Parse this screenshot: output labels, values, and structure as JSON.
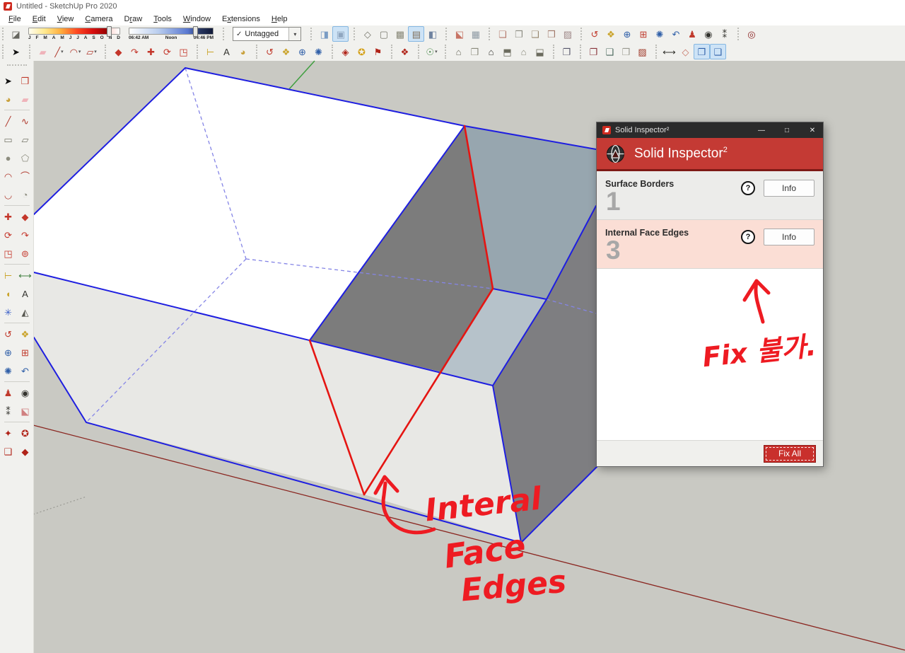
{
  "window": {
    "title": "Untitled - SketchUp Pro 2020",
    "menus": [
      {
        "label": "File",
        "accel": 0
      },
      {
        "label": "Edit",
        "accel": 0
      },
      {
        "label": "View",
        "accel": 0
      },
      {
        "label": "Camera",
        "accel": 0
      },
      {
        "label": "Draw",
        "accel": 1
      },
      {
        "label": "Tools",
        "accel": 0
      },
      {
        "label": "Window",
        "accel": 0
      },
      {
        "label": "Extensions",
        "accel": 1
      },
      {
        "label": "Help",
        "accel": 0
      }
    ]
  },
  "toolbar1": {
    "shadow_icon": {
      "name": "shadows-toggle-icon",
      "glyph": "◪",
      "color": "#66665f"
    },
    "date_slider": {
      "months": "JFMAMJJASOND",
      "handle_pct": 86
    },
    "time_slider": {
      "start": "06:42 AM",
      "mid": "Noon",
      "end": "04:46 PM",
      "handle_pct": 76
    },
    "tag_combo": {
      "check": "✓",
      "label": "Untagged",
      "drop": "▾"
    },
    "groups": [
      {
        "gname": "style-edges",
        "icons": [
          {
            "name": "xray-mode-icon",
            "glyph": "◨",
            "color": "#7a9cc4",
            "active": false
          },
          {
            "name": "back-edges-icon",
            "glyph": "▣",
            "color": "#8fa6c0",
            "active": true
          }
        ]
      },
      {
        "gname": "face-styles",
        "icons": [
          {
            "name": "wireframe-icon",
            "glyph": "◇",
            "color": "#77776c",
            "active": false
          },
          {
            "name": "hidden-line-icon",
            "glyph": "▢",
            "color": "#77776c",
            "active": false
          },
          {
            "name": "shaded-icon",
            "glyph": "▩",
            "color": "#8a8a7a",
            "active": false
          },
          {
            "name": "shaded-textures-icon",
            "glyph": "▤",
            "color": "#7f6f5a",
            "active": true
          },
          {
            "name": "monochrome-icon",
            "glyph": "◧",
            "color": "#6f83a0",
            "active": false
          }
        ]
      },
      {
        "gname": "section",
        "icons": [
          {
            "name": "section-plane-icon",
            "glyph": "⬕",
            "color": "#c77364",
            "active": false
          },
          {
            "name": "section-fill-icon",
            "glyph": "▦",
            "color": "#8e9aa4",
            "active": false
          }
        ]
      },
      {
        "gname": "sandbox",
        "icons": [
          {
            "name": "stamp-tool-icon",
            "glyph": "❏",
            "color": "#b4786a",
            "active": false
          },
          {
            "name": "smoove-tool-icon",
            "glyph": "❐",
            "color": "#8a8a80",
            "active": false
          },
          {
            "name": "lathe-tool-icon",
            "glyph": "❑",
            "color": "#97876f",
            "active": false
          },
          {
            "name": "terrain-tool-icon",
            "glyph": "❒",
            "color": "#a07868",
            "active": false
          },
          {
            "name": "drape-tool-icon",
            "glyph": "▨",
            "color": "#a08a8a",
            "active": false
          }
        ]
      },
      {
        "gname": "camera",
        "icons": [
          {
            "name": "orbit-icon",
            "glyph": "↺",
            "color": "#c03a2c",
            "active": false
          },
          {
            "name": "pan-icon",
            "glyph": "❖",
            "color": "#c9a227",
            "active": false
          },
          {
            "name": "zoom-icon",
            "glyph": "⊕",
            "color": "#2f5fa8",
            "active": false
          },
          {
            "name": "zoom-window-icon",
            "glyph": "⊞",
            "color": "#c03a2c",
            "active": false
          },
          {
            "name": "zoom-extents-icon",
            "glyph": "✺",
            "color": "#2f5fa8",
            "active": false
          },
          {
            "name": "previous-view-icon",
            "glyph": "↶",
            "color": "#2f5fa8",
            "active": false
          },
          {
            "name": "position-camera-icon",
            "glyph": "♟",
            "color": "#c03a2c",
            "active": false
          },
          {
            "name": "look-around-icon",
            "glyph": "◉",
            "color": "#33332e",
            "active": false
          },
          {
            "name": "walk-icon",
            "glyph": "⁑",
            "color": "#33332e",
            "active": false
          }
        ]
      },
      {
        "gname": "inspector",
        "icons": [
          {
            "name": "solid-inspector-icon",
            "glyph": "◎",
            "color": "#8a1f1f",
            "active": false
          }
        ]
      }
    ]
  },
  "toolbar2": {
    "groups": [
      {
        "gname": "select",
        "icons": [
          {
            "name": "select-tool-icon",
            "glyph": "➤",
            "color": "#111111",
            "active": false
          }
        ]
      },
      {
        "gname": "draw",
        "icons": [
          {
            "name": "eraser-tool-icon",
            "glyph": "▰",
            "color": "#efb3ba",
            "active": false
          },
          {
            "name": "line-tool-icon",
            "glyph": "╱",
            "color": "#b03a2e",
            "active": false,
            "caret": true
          },
          {
            "name": "arc-tool-icon",
            "glyph": "◠",
            "color": "#b03a2e",
            "active": false,
            "caret": true
          },
          {
            "name": "shape-tool-icon",
            "glyph": "▱",
            "color": "#b03a2e",
            "active": false,
            "caret": true
          }
        ]
      },
      {
        "gname": "modify",
        "icons": [
          {
            "name": "push-pull-icon",
            "glyph": "◆",
            "color": "#c4362a",
            "active": false
          },
          {
            "name": "follow-me-icon",
            "glyph": "↷",
            "color": "#c4362a",
            "active": false
          },
          {
            "name": "move-tool-icon",
            "glyph": "✚",
            "color": "#c4362a",
            "active": false
          },
          {
            "name": "rotate-tool-icon",
            "glyph": "⟳",
            "color": "#c4362a",
            "active": false
          },
          {
            "name": "scale-tool-icon",
            "glyph": "◳",
            "color": "#c4362a",
            "active": false
          }
        ]
      },
      {
        "gname": "annotate",
        "icons": [
          {
            "name": "tape-measure-icon",
            "glyph": "⊢",
            "color": "#c9a227",
            "active": false
          },
          {
            "name": "text-tool-icon",
            "glyph": "A",
            "color": "#33332e",
            "active": false
          },
          {
            "name": "paint-bucket-icon",
            "glyph": "◕",
            "color": "#c8a03a",
            "active": false
          }
        ]
      },
      {
        "gname": "camera2",
        "icons": [
          {
            "name": "orbit-icon",
            "glyph": "↺",
            "color": "#c03a2c",
            "active": false
          },
          {
            "name": "pan-icon",
            "glyph": "❖",
            "color": "#c9a227",
            "active": false
          },
          {
            "name": "zoom-icon",
            "glyph": "⊕",
            "color": "#2f5fa8",
            "active": false
          },
          {
            "name": "zoom-extents-icon",
            "glyph": "✺",
            "color": "#2f5fa8",
            "active": false
          }
        ]
      },
      {
        "gname": "model-checks",
        "icons": [
          {
            "name": "model-info-icon",
            "glyph": "◈",
            "color": "#b02318",
            "active": false
          },
          {
            "name": "fix-warning-icon",
            "glyph": "✪",
            "color": "#d4a017",
            "active": false
          },
          {
            "name": "purge-icon",
            "glyph": "⚑",
            "color": "#b02318",
            "active": false
          }
        ]
      },
      {
        "gname": "tags",
        "icons": [
          {
            "name": "tag-icon",
            "glyph": "❖",
            "color": "#b02318",
            "active": false
          }
        ]
      },
      {
        "gname": "account",
        "icons": [
          {
            "name": "account-icon",
            "glyph": "☉",
            "color": "#4a8a4a",
            "active": false,
            "caret": true
          }
        ]
      },
      {
        "gname": "warehouse",
        "icons": [
          {
            "name": "house-3d-icon",
            "glyph": "⌂",
            "color": "#6b6b5e",
            "active": false
          },
          {
            "name": "component-box-icon",
            "glyph": "❒",
            "color": "#8a8a7c",
            "active": false
          },
          {
            "name": "house-front-icon",
            "glyph": "⌂",
            "color": "#33332e",
            "active": false
          },
          {
            "name": "house-flat-icon",
            "glyph": "⬒",
            "color": "#6b6b5e",
            "active": false
          },
          {
            "name": "house-outline-icon",
            "glyph": "⌂",
            "color": "#8a8a7c",
            "active": false
          },
          {
            "name": "bin-icon",
            "glyph": "⬓",
            "color": "#6b6b5e",
            "active": false
          }
        ]
      },
      {
        "gname": "components-a",
        "icons": [
          {
            "name": "component-icon",
            "glyph": "❐",
            "color": "#55556a",
            "active": false
          }
        ]
      },
      {
        "gname": "components-b",
        "icons": [
          {
            "name": "component-edit-icon",
            "glyph": "❐",
            "color": "#88333a",
            "active": false
          },
          {
            "name": "component-reload-icon",
            "glyph": "❑",
            "color": "#46655a",
            "active": false
          },
          {
            "name": "component-lock-icon",
            "glyph": "❒",
            "color": "#99998f",
            "active": false
          },
          {
            "name": "component-report-icon",
            "glyph": "▨",
            "color": "#a03a2a",
            "active": false
          }
        ]
      },
      {
        "gname": "components-c",
        "icons": [
          {
            "name": "flip-icon",
            "glyph": "⟷",
            "color": "#33332e",
            "active": false
          },
          {
            "name": "outline-box-icon",
            "glyph": "◇",
            "color": "#c77364",
            "active": false
          },
          {
            "name": "component-blue-a-icon",
            "glyph": "❐",
            "color": "#2f5fa8",
            "active": true
          },
          {
            "name": "component-blue-b-icon",
            "glyph": "❑",
            "color": "#2f5fa8",
            "active": true
          }
        ]
      }
    ]
  },
  "sidebar": {
    "rows": [
      {
        "sep": false,
        "tools": [
          {
            "name": "select-tool-icon",
            "glyph": "➤",
            "color": "#111111"
          },
          {
            "name": "make-component-icon",
            "glyph": "❒",
            "color": "#c0392b"
          }
        ]
      },
      {
        "sep": true,
        "tools": [
          {
            "name": "paint-bucket-icon",
            "glyph": "◕",
            "color": "#c8a03a"
          },
          {
            "name": "eraser-tool-icon",
            "glyph": "▰",
            "color": "#efb3ba"
          }
        ]
      },
      {
        "sep": false,
        "tools": [
          {
            "name": "line-tool-icon",
            "glyph": "╱",
            "color": "#b03a2e"
          },
          {
            "name": "freehand-tool-icon",
            "glyph": "∿",
            "color": "#b03a2e"
          }
        ]
      },
      {
        "sep": false,
        "tools": [
          {
            "name": "rectangle-tool-icon",
            "glyph": "▭",
            "color": "#77776a"
          },
          {
            "name": "rotated-rectangle-icon",
            "glyph": "▱",
            "color": "#77776a"
          }
        ]
      },
      {
        "sep": false,
        "tools": [
          {
            "name": "circle-tool-icon",
            "glyph": "●",
            "color": "#8d8d7f"
          },
          {
            "name": "polygon-tool-icon",
            "glyph": "⬠",
            "color": "#8d8d7f"
          }
        ]
      },
      {
        "sep": false,
        "tools": [
          {
            "name": "arc-tool-icon",
            "glyph": "◠",
            "color": "#b03a2e"
          },
          {
            "name": "two-point-arc-icon",
            "glyph": "⌒",
            "color": "#b03a2e"
          }
        ]
      },
      {
        "sep": true,
        "tools": [
          {
            "name": "three-point-arc-icon",
            "glyph": "◡",
            "color": "#b03a2e"
          },
          {
            "name": "pie-tool-icon",
            "glyph": "◔",
            "color": "#8d8d7f"
          }
        ]
      },
      {
        "sep": false,
        "tools": [
          {
            "name": "move-tool-icon",
            "glyph": "✚",
            "color": "#c4362a"
          },
          {
            "name": "push-pull-icon",
            "glyph": "◆",
            "color": "#c4362a"
          }
        ]
      },
      {
        "sep": false,
        "tools": [
          {
            "name": "rotate-tool-icon",
            "glyph": "⟳",
            "color": "#c4362a"
          },
          {
            "name": "follow-me-icon",
            "glyph": "↷",
            "color": "#c4362a"
          }
        ]
      },
      {
        "sep": true,
        "tools": [
          {
            "name": "scale-tool-icon",
            "glyph": "◳",
            "color": "#c4362a"
          },
          {
            "name": "offset-tool-icon",
            "glyph": "⊚",
            "color": "#c4362a"
          }
        ]
      },
      {
        "sep": false,
        "tools": [
          {
            "name": "tape-measure-icon",
            "glyph": "⊢",
            "color": "#c9a227"
          },
          {
            "name": "dimension-tool-icon",
            "glyph": "⟷",
            "color": "#3f7f3f"
          }
        ]
      },
      {
        "sep": false,
        "tools": [
          {
            "name": "protractor-tool-icon",
            "glyph": "◖",
            "color": "#c9a227"
          },
          {
            "name": "text-tool-icon",
            "glyph": "A",
            "color": "#33332e"
          }
        ]
      },
      {
        "sep": true,
        "tools": [
          {
            "name": "axes-tool-icon",
            "glyph": "✳",
            "color": "#3a5fc8"
          },
          {
            "name": "three-d-text-icon",
            "glyph": "◭",
            "color": "#55554e"
          }
        ]
      },
      {
        "sep": false,
        "tools": [
          {
            "name": "orbit-icon",
            "glyph": "↺",
            "color": "#c03a2c"
          },
          {
            "name": "pan-icon",
            "glyph": "❖",
            "color": "#c9a227"
          }
        ]
      },
      {
        "sep": false,
        "tools": [
          {
            "name": "zoom-icon",
            "glyph": "⊕",
            "color": "#2f5fa8"
          },
          {
            "name": "zoom-window-icon",
            "glyph": "⊞",
            "color": "#c03a2c"
          }
        ]
      },
      {
        "sep": true,
        "tools": [
          {
            "name": "zoom-extents-icon",
            "glyph": "✺",
            "color": "#2f5fa8"
          },
          {
            "name": "previous-view-icon",
            "glyph": "↶",
            "color": "#2f5fa8"
          }
        ]
      },
      {
        "sep": false,
        "tools": [
          {
            "name": "position-camera-icon",
            "glyph": "♟",
            "color": "#c03a2c"
          },
          {
            "name": "look-around-icon",
            "glyph": "◉",
            "color": "#33332e"
          }
        ]
      },
      {
        "sep": true,
        "tools": [
          {
            "name": "walk-icon",
            "glyph": "⁑",
            "color": "#33332e"
          },
          {
            "name": "section-plane-icon",
            "glyph": "⬕",
            "color": "#d08080"
          }
        ]
      },
      {
        "sep": false,
        "tools": [
          {
            "name": "warehouse-share-icon",
            "glyph": "✦",
            "color": "#b02318"
          },
          {
            "name": "warehouse-download-icon",
            "glyph": "✪",
            "color": "#b02318"
          }
        ]
      },
      {
        "sep": false,
        "tools": [
          {
            "name": "warehouse-extension-icon",
            "glyph": "❑",
            "color": "#b02318"
          },
          {
            "name": "warehouse-model-icon",
            "glyph": "◆",
            "color": "#b02318"
          }
        ]
      }
    ]
  },
  "dialog": {
    "titlebar": {
      "title": "Solid Inspector²",
      "minimize": "—",
      "maximize": "□",
      "close": "✕"
    },
    "header": {
      "title": "Solid Inspector",
      "sup": "2"
    },
    "rows": [
      {
        "label": "Surface Borders",
        "count": "1",
        "help": "?",
        "info_label": "Info",
        "variant": "normal"
      },
      {
        "label": "Internal Face Edges",
        "count": "3",
        "help": "?",
        "info_label": "Info",
        "variant": "alert"
      }
    ],
    "footer": {
      "fix_all_label": "Fix All"
    }
  },
  "annotations": {
    "fix_note": "Fix 불가.",
    "edge_note_1": "Interal",
    "edge_note_2": "Face",
    "edge_note_3": "Edges"
  },
  "colors": {
    "canvas_bg": "#c9c9c3",
    "edge_blue": "#1e1ee0",
    "hidden_edge_blue": "#8585e6",
    "error_edge_red": "#e51512",
    "annotation_red": "#ee1b22",
    "dialog_header_red": "#c43a34",
    "fix_all_red": "#c9302c",
    "row_alert_bg": "#fbded5",
    "axis_red": "#8a2620",
    "axis_green": "#3f9f3f",
    "face_white": "#ffffff",
    "face_front": "#e8e8e5",
    "face_dark_gray": "#7c7c7c",
    "face_steel": "#97a6af",
    "face_light_steel": "#b6c2ca"
  }
}
